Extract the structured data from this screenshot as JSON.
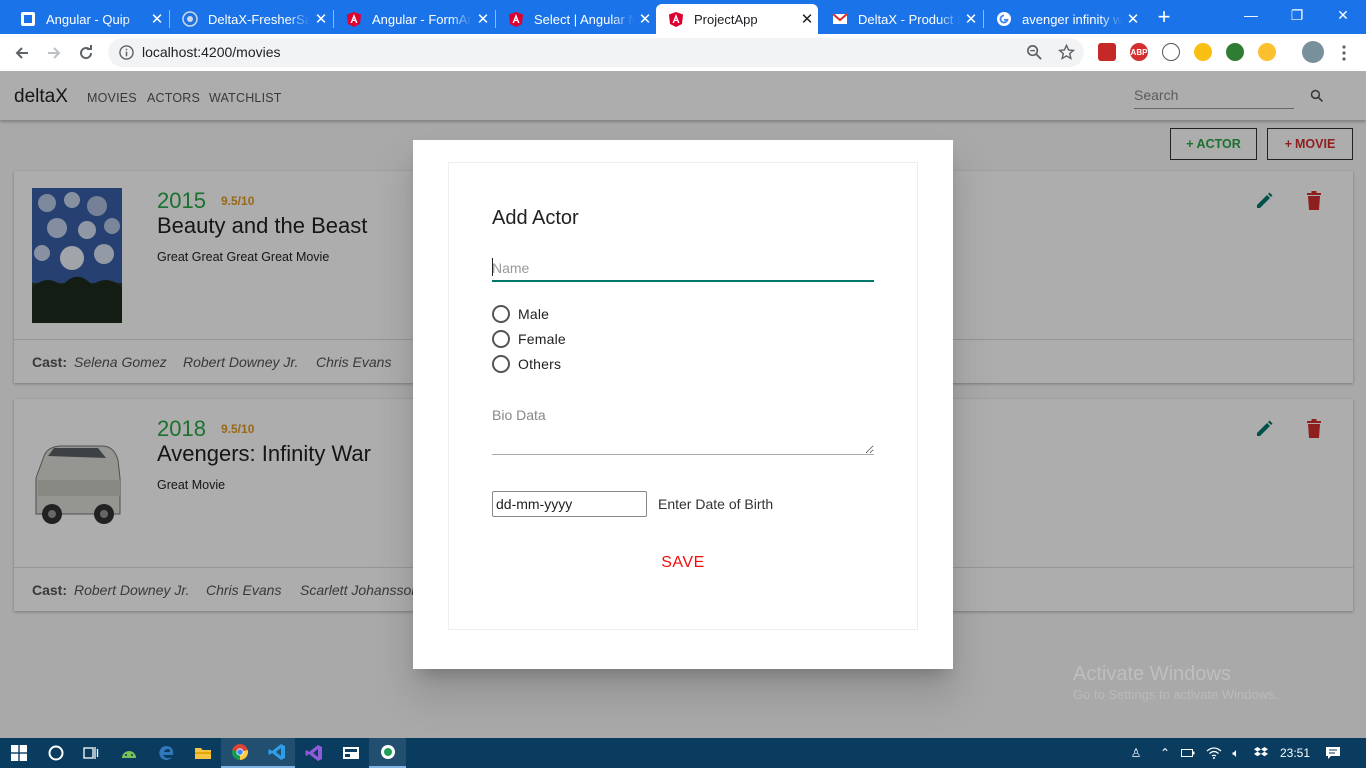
{
  "browser": {
    "tabs": [
      {
        "title": "Angular - Quip",
        "icon": "quip-icon"
      },
      {
        "title": "DeltaX-FresherSample",
        "icon": "github-icon"
      },
      {
        "title": "Angular - FormArray",
        "icon": "angular-icon"
      },
      {
        "title": "Select | Angular Material",
        "icon": "angular-icon"
      },
      {
        "title": "ProjectApp",
        "icon": "angular-icon",
        "active": true
      },
      {
        "title": "DeltaX - Product Engineering",
        "icon": "gmail-icon"
      },
      {
        "title": "avenger infinity war",
        "icon": "google-icon"
      }
    ],
    "new_tab": "+",
    "url": "localhost:4200/movies",
    "window_controls": {
      "minimize": "—",
      "restore": "❐",
      "close": "✕"
    }
  },
  "app": {
    "brand": "deltaX",
    "nav": [
      "MOVIES",
      "ACTORS",
      "WATCHLIST"
    ],
    "search_placeholder": "Search",
    "add_actor_label": "ACTOR",
    "add_movie_label": "MOVIE"
  },
  "movies": [
    {
      "year": "2015",
      "rating": "9.5/10",
      "title": "Beauty and the Beast",
      "description": "Great Great Great Great Movie",
      "cast_label": "Cast:",
      "cast": [
        "Selena Gomez",
        "Robert Downey Jr.",
        "Chris Evans"
      ]
    },
    {
      "year": "2018",
      "rating": "9.5/10",
      "title": "Avengers: Infinity War",
      "description": "Great Movie",
      "cast_label": "Cast:",
      "cast": [
        "Robert Downey Jr.",
        "Chris Evans",
        "Scarlett Johansson"
      ]
    }
  ],
  "dialog": {
    "title": "Add Actor",
    "name_placeholder": "Name",
    "gender_options": [
      "Male",
      "Female",
      "Others"
    ],
    "bio_label": "Bio Data",
    "dob_value": "dd-mm-yyyy",
    "dob_label": "Enter Date of Birth",
    "save_label": "SAVE"
  },
  "watermark": {
    "line1": "Activate Windows",
    "line2": "Go to Settings to activate Windows."
  },
  "taskbar": {
    "clock": "23:51",
    "apps": [
      "start-icon",
      "cortana-icon",
      "task-view-icon",
      "android-studio-icon",
      "edge-icon",
      "file-explorer-icon",
      "chrome-icon",
      "vscode-icon",
      "visual-studio-icon",
      "snipping-tool-icon",
      "app-icon"
    ]
  },
  "colors": {
    "chrome_blue": "#1a73e8",
    "accent_green": "#28a745",
    "rating_orange": "#e09b21",
    "input_teal": "#00796b",
    "save_red": "#f30c0c",
    "taskbar": "#0a3c60"
  }
}
